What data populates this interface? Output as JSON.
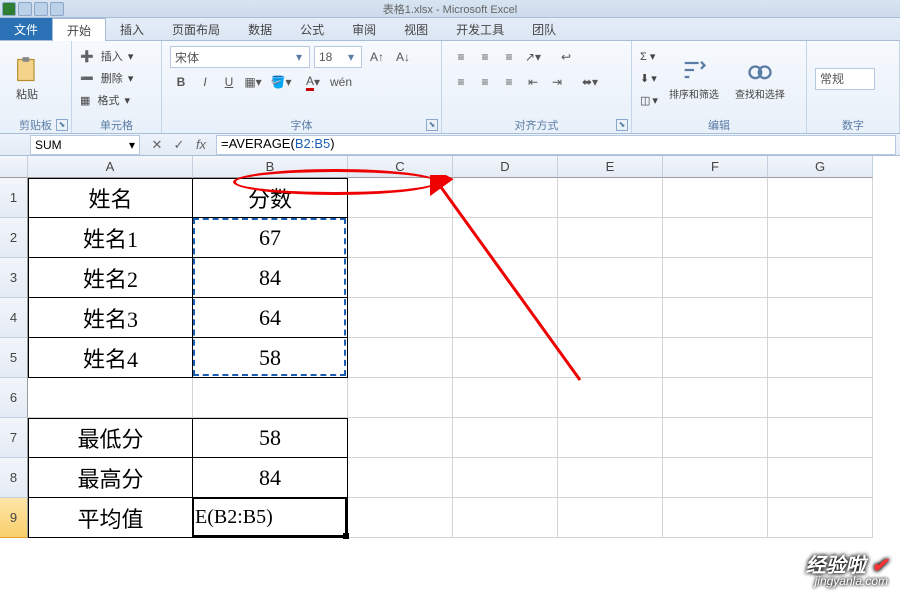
{
  "window": {
    "title": "表格1.xlsx - Microsoft Excel"
  },
  "menu": {
    "file": "文件",
    "tabs": [
      "开始",
      "插入",
      "页面布局",
      "数据",
      "公式",
      "审阅",
      "视图",
      "开发工具",
      "团队"
    ],
    "active": 0
  },
  "ribbon": {
    "clipboard": {
      "label": "剪贴板",
      "paste": "粘贴"
    },
    "cells": {
      "label": "单元格",
      "insert": "插入",
      "delete": "删除",
      "format": "格式"
    },
    "font": {
      "label": "字体",
      "name": "宋体",
      "size": "18"
    },
    "align": {
      "label": "对齐方式"
    },
    "editing": {
      "label": "编辑",
      "sort": "排序和筛选",
      "find": "查找和选择"
    },
    "normal": {
      "label": "常规"
    },
    "number": {
      "label": "数字"
    }
  },
  "formula_bar": {
    "name_box": "SUM",
    "formula_prefix": "=AVERAGE(",
    "formula_ref": "B2:B5",
    "formula_suffix": ")"
  },
  "columns": [
    {
      "id": "A",
      "w": 165
    },
    {
      "id": "B",
      "w": 155
    },
    {
      "id": "C",
      "w": 105
    },
    {
      "id": "D",
      "w": 105
    },
    {
      "id": "E",
      "w": 105
    },
    {
      "id": "F",
      "w": 105
    },
    {
      "id": "G",
      "w": 105
    }
  ],
  "rows": [
    {
      "n": 1,
      "h": 40
    },
    {
      "n": 2,
      "h": 40
    },
    {
      "n": 3,
      "h": 40
    },
    {
      "n": 4,
      "h": 40
    },
    {
      "n": 5,
      "h": 40
    },
    {
      "n": 6,
      "h": 40
    },
    {
      "n": 7,
      "h": 40
    },
    {
      "n": 8,
      "h": 40
    },
    {
      "n": 9,
      "h": 40
    }
  ],
  "cells": {
    "A1": "姓名",
    "B1": "分数",
    "A2": "姓名1",
    "B2": "67",
    "A3": "姓名2",
    "B3": "84",
    "A4": "姓名3",
    "B4": "64",
    "A5": "姓名4",
    "B5": "58",
    "A7": "最低分",
    "B7": "58",
    "A8": "最高分",
    "B8": "84",
    "A9": "平均值",
    "B9": "E(B2:B5)"
  },
  "watermark": {
    "line1_a": "经验啦",
    "check": "✔",
    "line2": "jingyanla.com"
  }
}
